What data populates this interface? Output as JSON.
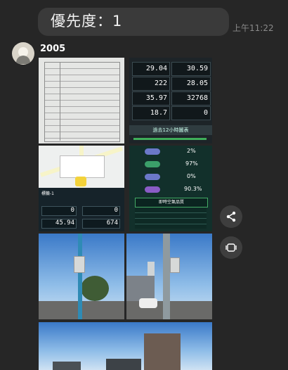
{
  "message": {
    "text": "優先度：1",
    "time": "上午11:22"
  },
  "sender": {
    "name": "2005"
  },
  "dashboard": {
    "values": [
      "29.04",
      "30.59",
      "222",
      "28.05",
      "35.97",
      "32768",
      "18.7",
      "0"
    ],
    "chart_title": "過去12小時圖表"
  },
  "map": {
    "title": "標籤-1",
    "values": [
      "0",
      "0",
      "45.94",
      "674"
    ]
  },
  "dashboard2": {
    "values": [
      "2%",
      "97%",
      "0%",
      "90.3%"
    ],
    "table_title": "即時空氣品質"
  },
  "actions": {
    "share_icon": "share-icon",
    "screen_icon": "screen-icon"
  }
}
